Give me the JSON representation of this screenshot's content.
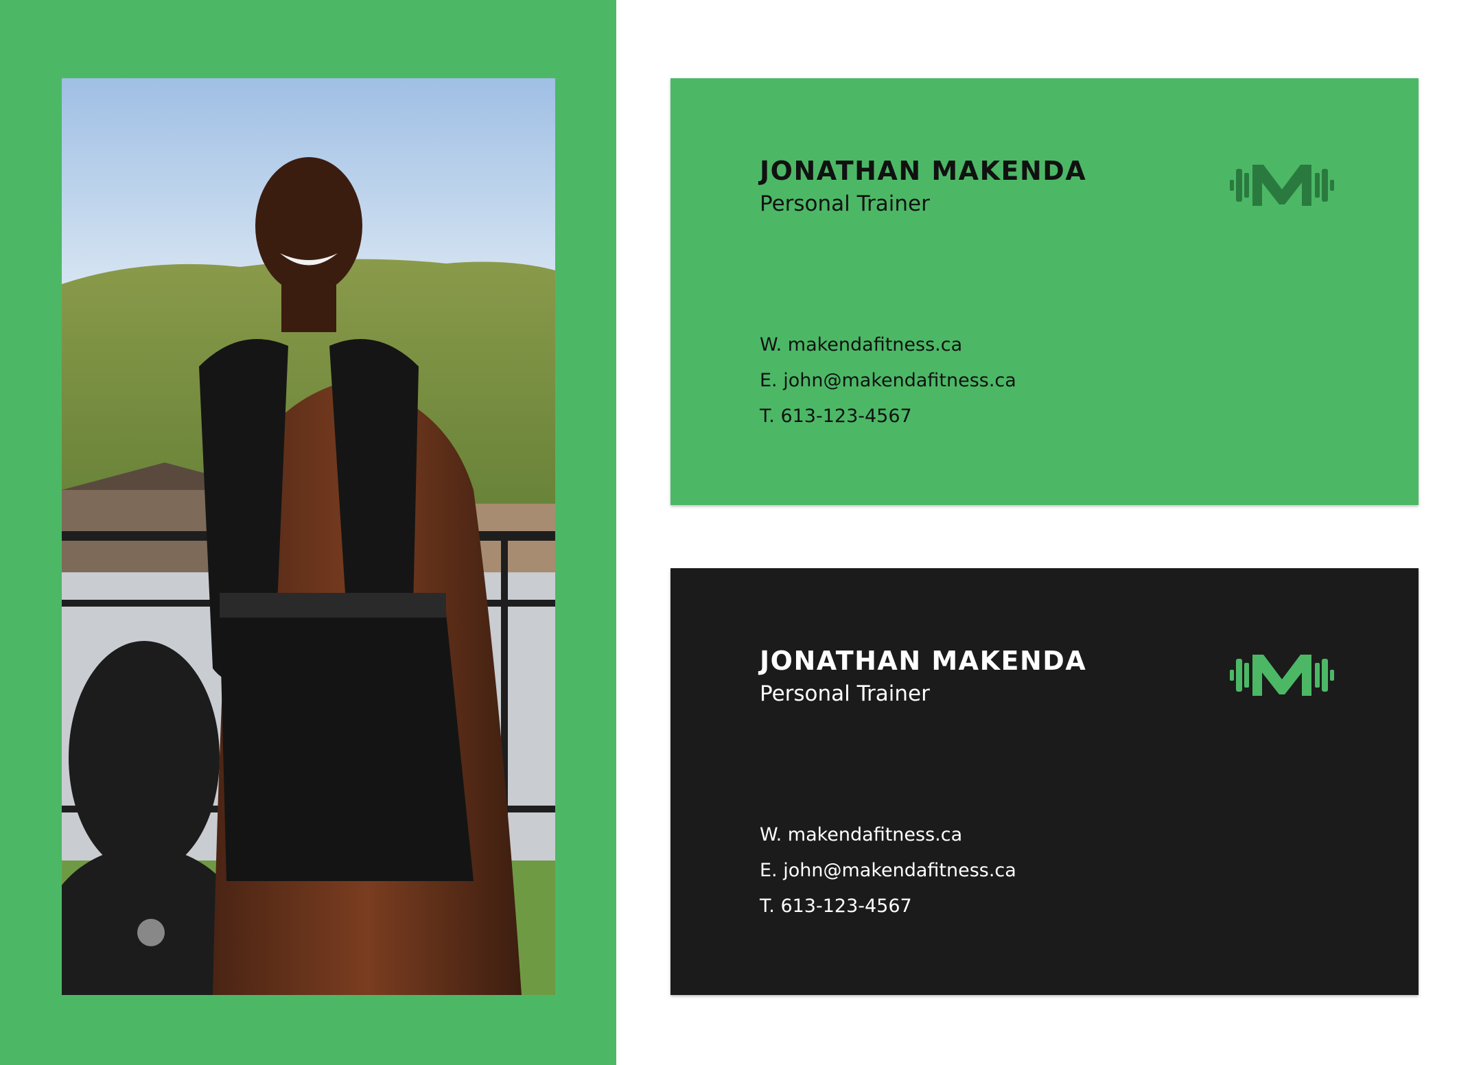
{
  "colors": {
    "brand_green": "#4cb866",
    "logo_dark_green": "#2a7a3f",
    "dark_card": "#1b1b1b",
    "white": "#ffffff"
  },
  "photo": {
    "icon": "trainer-photo"
  },
  "cards": [
    {
      "variant": "green",
      "name": "JONATHAN MAKENDA",
      "role": "Personal Trainer",
      "website": "W. makendafitness.ca",
      "email": "E. john@makendafitness.ca",
      "phone": "T. 613-123-4567",
      "logo_icon": "dumbbell-m-logo-icon"
    },
    {
      "variant": "dark",
      "name": "JONATHAN MAKENDA",
      "role": "Personal Trainer",
      "website": "W. makendafitness.ca",
      "email": "E. john@makendafitness.ca",
      "phone": "T. 613-123-4567",
      "logo_icon": "dumbbell-m-logo-icon"
    }
  ]
}
